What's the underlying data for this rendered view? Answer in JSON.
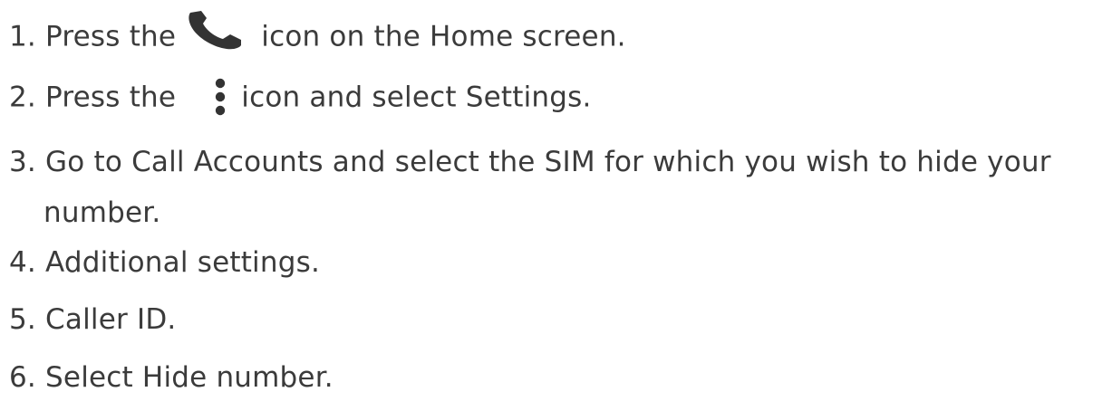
{
  "steps": [
    {
      "number": "1.",
      "before": "Press the",
      "icon": "phone-icon",
      "after": "icon on the Home screen."
    },
    {
      "number": "2.",
      "before": "Press the",
      "icon": "more-vertical-icon",
      "after": "icon and select Settings."
    },
    {
      "number": "3.",
      "text": "Go to Call Accounts and select the SIM for which you wish to hide your",
      "continuation": "number."
    },
    {
      "number": "4.",
      "text": "Additional settings."
    },
    {
      "number": "5.",
      "text": "Caller ID."
    },
    {
      "number": "6.",
      "text": "Select Hide number."
    }
  ]
}
